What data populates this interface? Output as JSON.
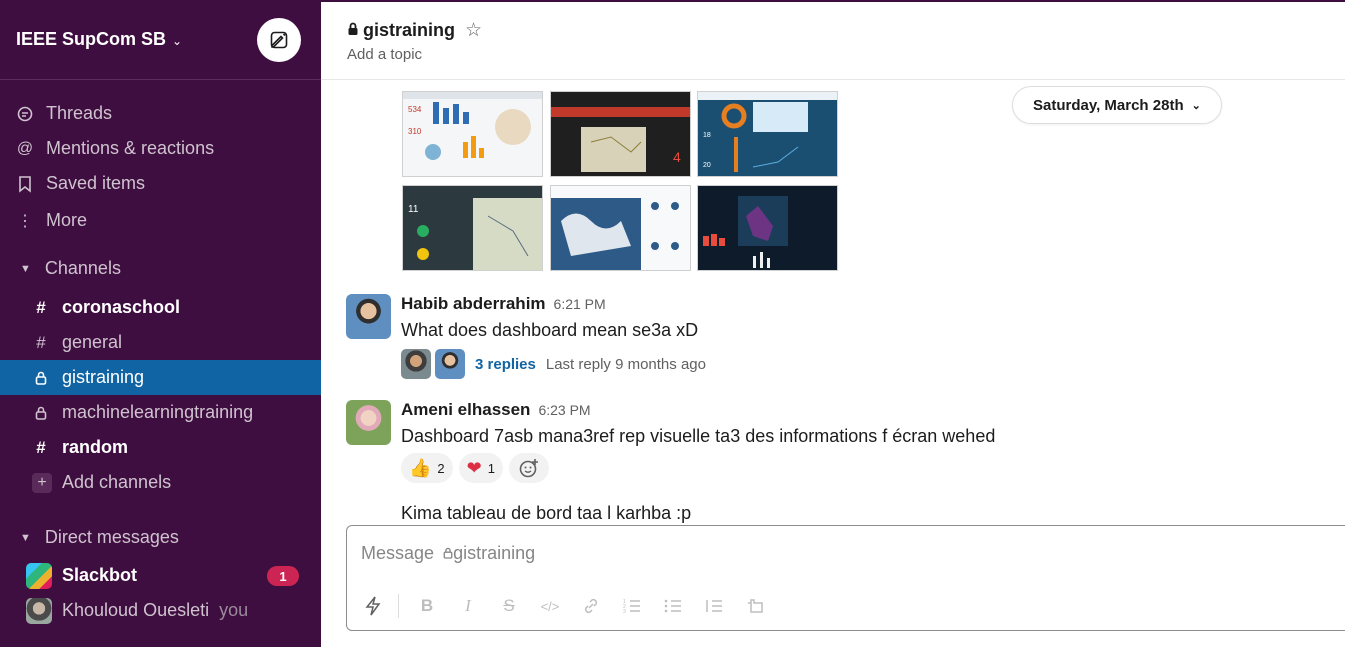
{
  "workspace": {
    "name": "IEEE SupCom SB"
  },
  "nav": {
    "threads": "Threads",
    "mentions": "Mentions & reactions",
    "saved": "Saved items",
    "more": "More"
  },
  "channels": {
    "header": "Channels",
    "items": [
      {
        "name": "coronaschool",
        "icon": "hash",
        "bold": true
      },
      {
        "name": "general",
        "icon": "hash",
        "bold": false
      },
      {
        "name": "gistraining",
        "icon": "lock",
        "active": true
      },
      {
        "name": "machinelearningtraining",
        "icon": "lock",
        "bold": false
      },
      {
        "name": "random",
        "icon": "hash",
        "bold": true
      }
    ],
    "add_label": "Add channels"
  },
  "dms": {
    "header": "Direct messages",
    "items": [
      {
        "name": "Slackbot",
        "badge": "1"
      },
      {
        "name": "Khouloud Ouesleti",
        "suffix": "you"
      }
    ]
  },
  "channel": {
    "name": "gistraining",
    "topic": "Add a topic"
  },
  "date_divider": "Saturday, March 28th",
  "messages": [
    {
      "author": "Habib abderrahim",
      "time": "6:21 PM",
      "text": "What does dashboard mean se3a xD"
    },
    {
      "author": "Ameni elhassen",
      "time": "6:23 PM",
      "text": "Dashboard 7asb mana3ref rep visuelle ta3 des informations f écran wehed"
    }
  ],
  "thread": {
    "replies": "3 replies",
    "meta": "Last reply 9 months ago"
  },
  "reactions": [
    {
      "emoji": "👍",
      "count": "2"
    },
    {
      "emoji": "❤",
      "count": "1"
    }
  ],
  "follow_text": "Kima tableau de bord taa l karhba :p",
  "composer": {
    "prefix": "Message",
    "channel": "gistraining"
  },
  "colors": {
    "sidebar": "#3f0e40",
    "active": "#1164a3",
    "badge": "#cd2553",
    "link": "#1264a3"
  }
}
